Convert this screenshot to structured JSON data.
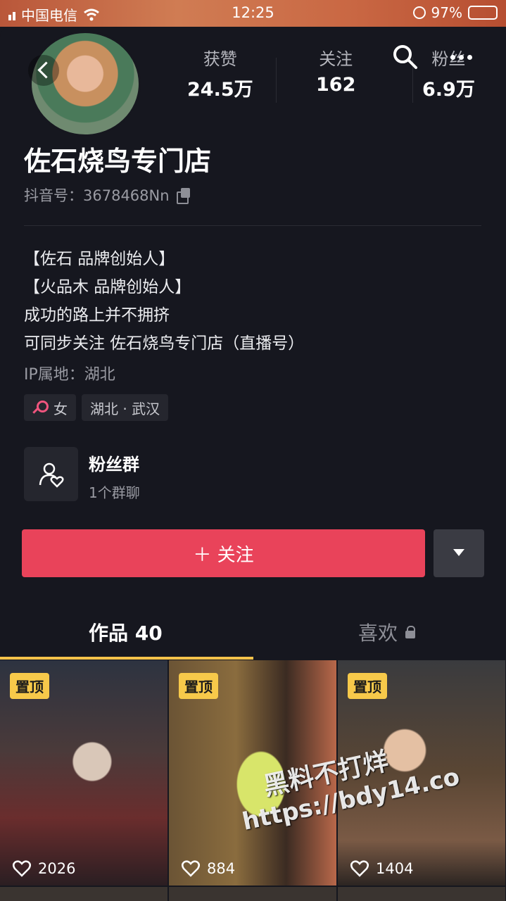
{
  "status_bar": {
    "carrier": "中国电信",
    "time": "12:25",
    "battery": "97%",
    "battery_level": 0.97
  },
  "profile": {
    "stats": [
      {
        "label": "获赞",
        "value": "24.5万"
      },
      {
        "label": "关注",
        "value": "162"
      },
      {
        "label": "粉丝",
        "value": "6.9万"
      }
    ],
    "name": "佐石烧鸟专门店",
    "douyin_id": "抖音号：3678468Nn",
    "bio": [
      "【佐石 品牌创始人】",
      "【火品木 品牌创始人】",
      "成功的路上并不拥挤",
      "可同步关注 佐石烧鸟专门店（直播号）"
    ],
    "ip": "IP属地：湖北",
    "tags": {
      "gender": "女",
      "location": "湖北 · 武汉"
    },
    "fan_group": {
      "title": "粉丝群",
      "subtitle": "1个群聊"
    },
    "follow_label": "＋ 关注"
  },
  "tabs": {
    "works": "作品 40",
    "likes": "喜欢"
  },
  "videos": [
    {
      "pinned": "置顶",
      "likes": "2026"
    },
    {
      "pinned": "置顶",
      "likes": "884"
    },
    {
      "pinned": "置顶",
      "likes": "1404"
    }
  ],
  "watermark": {
    "line1": "黑料不打烊",
    "line2": "https://bdy14.co"
  },
  "colors": {
    "accent": "#e9435a",
    "tab_indicator": "#f5c24a",
    "pin_badge": "#f7c94a",
    "background": "#16171f"
  }
}
